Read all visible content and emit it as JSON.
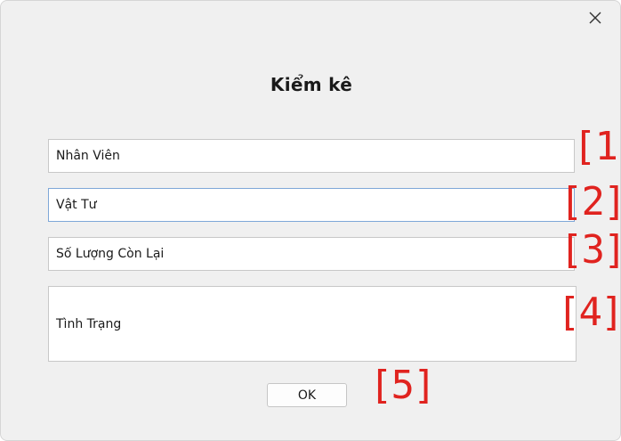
{
  "window": {
    "title": "Kiểm kê",
    "close_icon": "close-icon"
  },
  "form": {
    "employee_placeholder": "Nhân Viên",
    "material_placeholder": "Vật Tư",
    "remaining_quantity_placeholder": "Số Lượng Còn Lại",
    "status_placeholder": "Tình Trạng",
    "ok_label": "OK"
  },
  "annotations": {
    "a1": "[1]",
    "a2": "[2]",
    "a3": "[3]",
    "a4": "[4]",
    "a5": "[5]",
    "color": "#e0231f"
  },
  "colors": {
    "focus_border": "#7ea7d8",
    "background": "#f0f0f0"
  }
}
